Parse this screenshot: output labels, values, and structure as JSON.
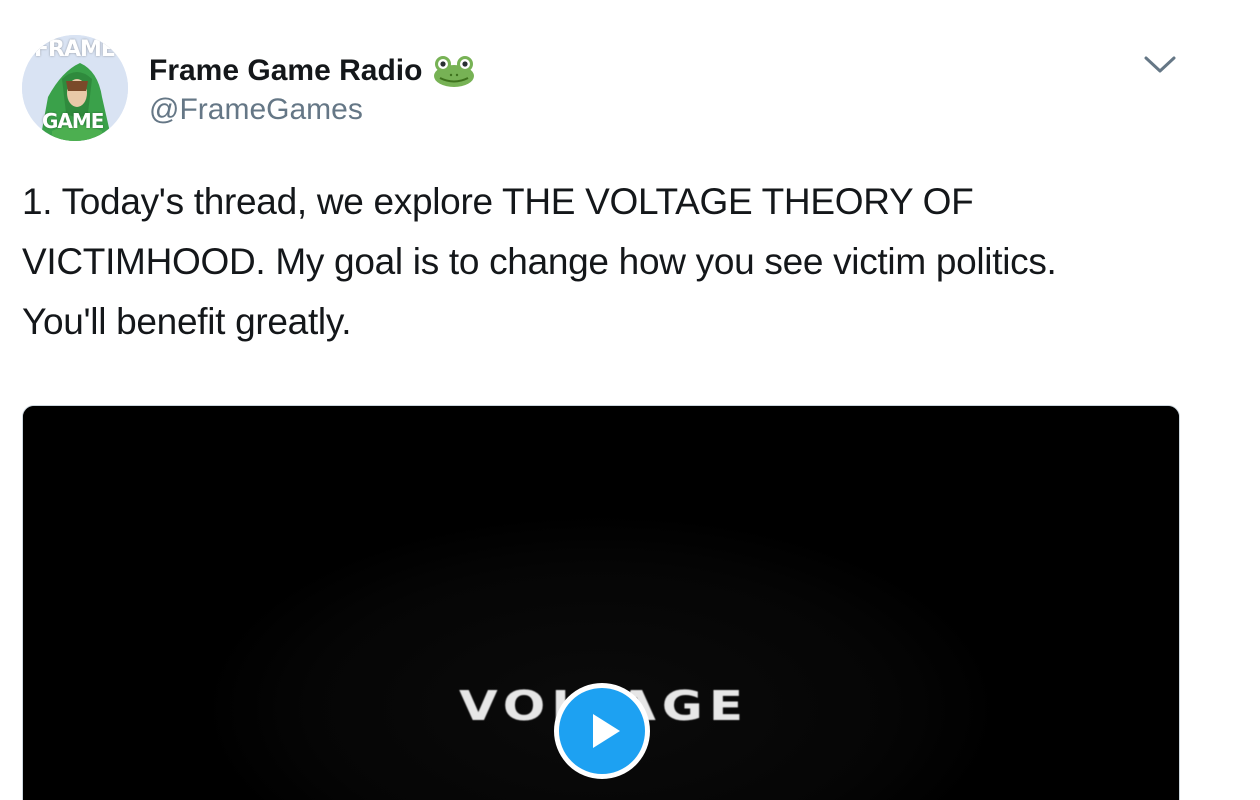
{
  "tweet": {
    "avatar": {
      "top_text": "FRAME",
      "bottom_text": "GAME"
    },
    "author": {
      "display_name": "Frame Game Radio",
      "handle": "@FrameGames",
      "badge_icon": "frog-icon"
    },
    "menu_icon": "chevron-down-icon",
    "text": "1. Today's thread, we explore THE VOLTAGE THEORY OF\nVICTIMHOOD. My goal is to change how you see victim politics.\nYou'll benefit greatly.",
    "media": {
      "type": "video",
      "overlay_title": "VOLTAGE",
      "play_icon": "play-icon",
      "colors": {
        "background": "#000000",
        "play_button": "#1da1f2"
      }
    }
  },
  "colors": {
    "primary_text": "#14171a",
    "secondary_text": "#657786",
    "accent": "#1da1f2"
  }
}
